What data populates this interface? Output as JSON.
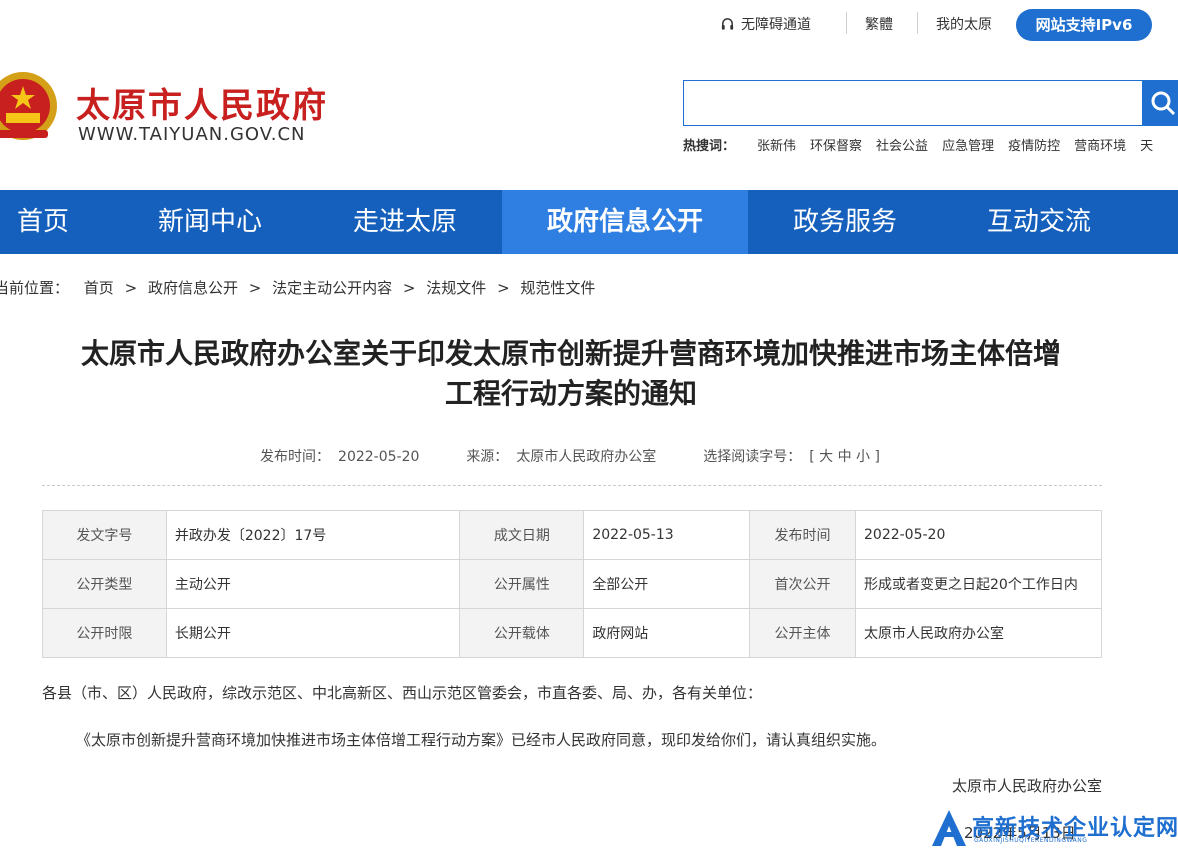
{
  "topbar": {
    "accessibility": "无障碍通道",
    "traditional": "繁體",
    "my_taiyuan": "我的太原",
    "ipv6": "网站支持IPv6"
  },
  "logo": {
    "title": "太原市人民政府",
    "url": "WWW.TAIYUAN.GOV.CN"
  },
  "search": {
    "placeholder": "",
    "hot_label": "热搜词：",
    "hot_terms": [
      "张新伟",
      "环保督察",
      "社会公益",
      "应急管理",
      "疫情防控",
      "营商环境",
      "天"
    ]
  },
  "nav": {
    "items": [
      "首页",
      "新闻中心",
      "走进太原",
      "政府信息公开",
      "政务服务",
      "互动交流"
    ],
    "active": "政府信息公开"
  },
  "breadcrumb": {
    "prefix": "当前位置：",
    "items": [
      "首页",
      "政府信息公开",
      "法定主动公开内容",
      "法规文件",
      "规范性文件"
    ],
    "separator": ">"
  },
  "article": {
    "title_line1": "太原市人民政府办公室关于印发太原市创新提升营商环境加快推进市场主体倍增",
    "title_line2": "工程行动方案的通知",
    "publish_label": "发布时间：",
    "publish_date": "2022-05-20",
    "source_label": "来源：",
    "source": "太原市人民政府办公室",
    "fontsize_label": "选择阅读字号：",
    "fontsize_options": "[ 大 中 小 ]"
  },
  "info_table": {
    "rows": [
      [
        "发文字号",
        "并政办发〔2022〕17号",
        "成文日期",
        "2022-05-13",
        "发布时间",
        "2022-05-20"
      ],
      [
        "公开类型",
        "主动公开",
        "公开属性",
        "全部公开",
        "首次公开",
        "形成或者变更之日起20个工作日内"
      ],
      [
        "公开时限",
        "长期公开",
        "公开载体",
        "政府网站",
        "公开主体",
        "太原市人民政府办公室"
      ]
    ]
  },
  "body": {
    "salutation": "各县（市、区）人民政府，综改示范区、中北高新区、西山示范区管委会，市直各委、局、办，各有关单位：",
    "paragraph": "《太原市创新提升营商环境加快推进市场主体倍增工程行动方案》已经市人民政府同意，现印发给你们，请认真组织实施。",
    "signer": "太原市人民政府办公室",
    "sign_date": "2022年5月13日"
  },
  "watermark": {
    "text": "高新技术企业认定网",
    "sub": "GAOXINJISHUQIYERENDINGWANG"
  },
  "colors": {
    "brand_red": "#c8201f",
    "nav_blue": "#1560bd",
    "nav_active": "#2f7fe2",
    "accent_blue": "#1e6fd0"
  }
}
